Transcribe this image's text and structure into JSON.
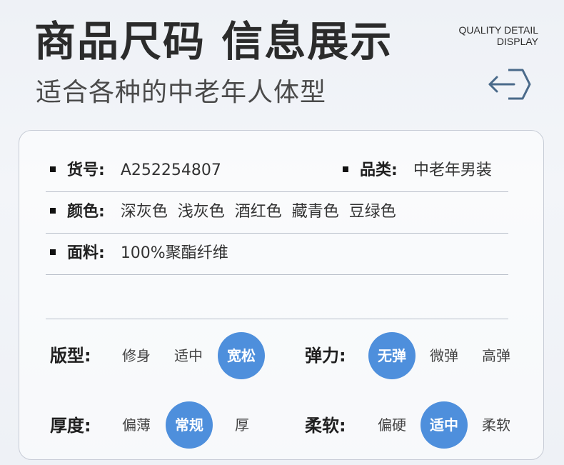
{
  "header": {
    "title": "商品尺码 信息展示",
    "subtitle": "适合各种的中老年人体型",
    "en_line1": "QUALITY DETAIL",
    "en_line2": "DISPLAY"
  },
  "info": {
    "item_no_label": "货号:",
    "item_no_value": "A252254807",
    "category_label": "品类:",
    "category_value": "中老年男装",
    "colors_label": "颜色:",
    "colors_value": "深灰色  浅灰色  酒红色  藏青色  豆绿色",
    "fabric_label": "面料:",
    "fabric_value": "100%聚酯纤维"
  },
  "attributes": {
    "fit": {
      "label": "版型:",
      "options": [
        "修身",
        "适中",
        "宽松"
      ],
      "selected": "宽松"
    },
    "elasticity": {
      "label": "弹力:",
      "options": [
        "无弹",
        "微弹",
        "高弹"
      ],
      "selected": "无弹"
    },
    "thickness": {
      "label": "厚度:",
      "options": [
        "偏薄",
        "常规",
        "厚"
      ],
      "selected": "常规"
    },
    "softness": {
      "label": "柔软:",
      "options": [
        "偏硬",
        "适中",
        "柔软"
      ],
      "selected": "适中"
    }
  },
  "colors": {
    "accent": "#4e8fdc",
    "icon": "#4a6a8a"
  },
  "icons": {
    "arrow": "arrow-left-hexagon-icon"
  }
}
